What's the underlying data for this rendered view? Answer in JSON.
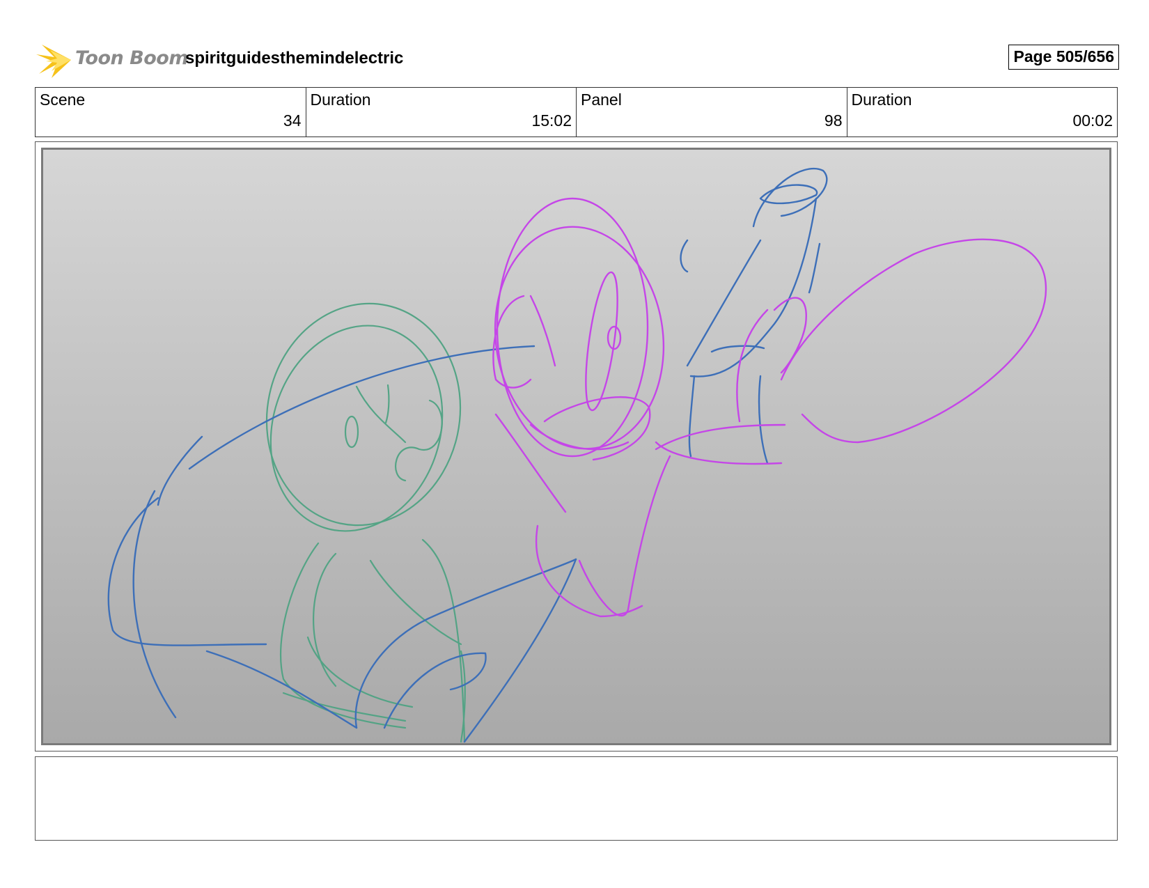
{
  "header": {
    "logo_text": "Toon Boom",
    "project_title": "spiritguidesthemindelectric",
    "page_label": "Page 505/656"
  },
  "info": {
    "scene": {
      "label": "Scene",
      "value": "34"
    },
    "scene_duration": {
      "label": "Duration",
      "value": "15:02"
    },
    "panel": {
      "label": "Panel",
      "value": "98"
    },
    "panel_duration": {
      "label": "Duration",
      "value": "00:02"
    }
  },
  "colors": {
    "sketch_green": "#4fa383",
    "sketch_blue": "#3d6fb8",
    "sketch_magenta": "#c546e8",
    "logo_yellow": "#f6c21a"
  },
  "notes": {
    "text": ""
  }
}
